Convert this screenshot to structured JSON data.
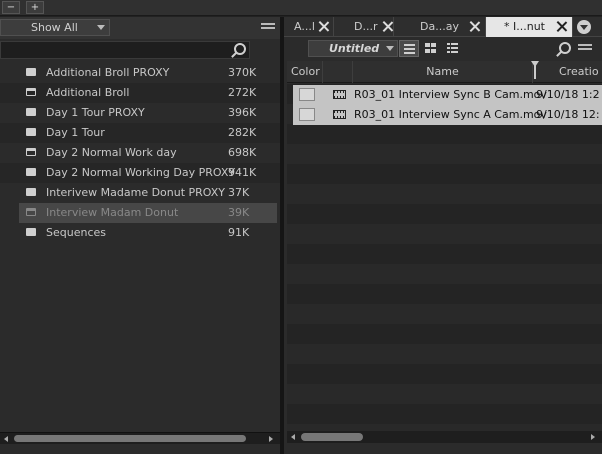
{
  "window": {
    "minus_label": "−",
    "plus_label": "+"
  },
  "left_panel": {
    "filter": {
      "selected": "Show All"
    },
    "bins": [
      {
        "name": "Additional Broll PROXY",
        "size": "370K",
        "icon": "bin-closed-icon"
      },
      {
        "name": "Additional Broll",
        "size": "272K",
        "icon": "bin-open-icon"
      },
      {
        "name": "Day 1 Tour PROXY",
        "size": "396K",
        "icon": "bin-closed-icon"
      },
      {
        "name": "Day 1 Tour",
        "size": "282K",
        "icon": "bin-closed-icon"
      },
      {
        "name": "Day 2 Normal Work day",
        "size": "698K",
        "icon": "bin-open-icon"
      },
      {
        "name": "Day 2 Normal Working Day PROXY",
        "size": "941K",
        "icon": "bin-closed-icon"
      },
      {
        "name": "Interivew Madame Donut PROXY",
        "size": "37K",
        "icon": "bin-closed-icon"
      },
      {
        "name": "Interview Madam Donut",
        "size": "39K",
        "icon": "bin-open-icon",
        "selected": true
      },
      {
        "name": "Sequences",
        "size": "91K",
        "icon": "bin-closed-icon"
      }
    ]
  },
  "right_panel": {
    "tabs": [
      {
        "label": "A...l",
        "active": false
      },
      {
        "label": "D...r",
        "active": false
      },
      {
        "label": "Da...ay",
        "active": false
      },
      {
        "label": "* I...nut",
        "active": true
      }
    ],
    "bin_name": "Untitled",
    "columns": [
      "Color",
      "",
      "Name",
      "Creatio"
    ],
    "clips": [
      {
        "name": "R03_01 Interview Sync B Cam.mov",
        "date": "9/10/18 1:2",
        "icon": "film-icon"
      },
      {
        "name": "R03_01 Interview Sync A Cam.mov",
        "date": "9/10/18 12:",
        "icon": "film-icon"
      }
    ]
  },
  "colors": {
    "background": "#2b2b2b",
    "selection": "#c4c4c4",
    "active_tab": "#e6e6e6"
  }
}
